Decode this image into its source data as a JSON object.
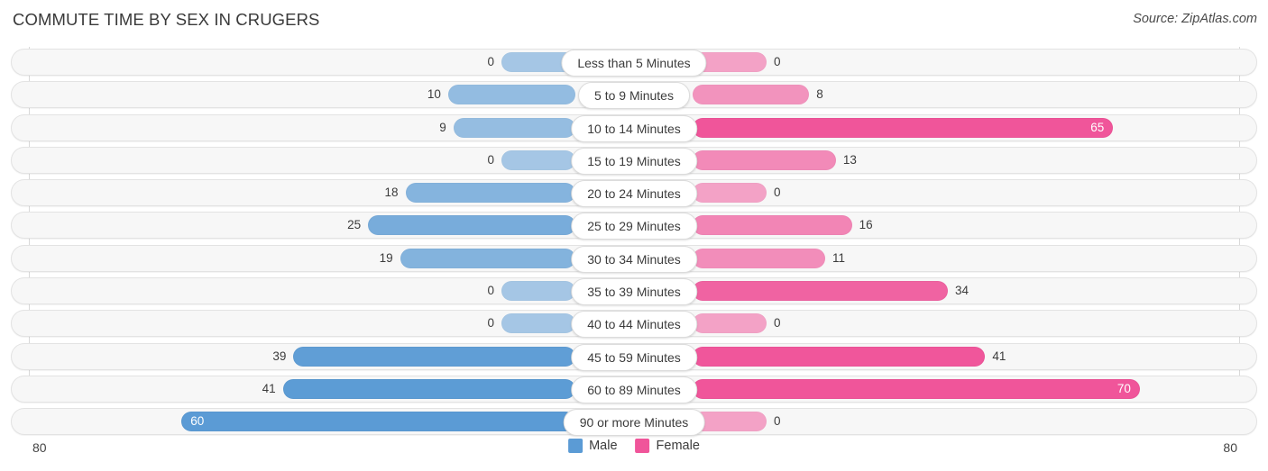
{
  "header": {
    "title": "COMMUTE TIME BY SEX IN CRUGERS",
    "source": "Source: ZipAtlas.com"
  },
  "legend": {
    "male_label": "Male",
    "female_label": "Female",
    "male_color": "#5b9bd5",
    "female_color": "#f0559a"
  },
  "axis": {
    "left_max_label": "80",
    "right_max_label": "80"
  },
  "chart_data": {
    "type": "bar",
    "title": "COMMUTE TIME BY SEX IN CRUGERS",
    "subtitle": "Source: ZipAtlas.com",
    "orientation": "horizontal-diverging",
    "xlabel": "",
    "ylabel": "",
    "xlim": [
      80,
      80
    ],
    "grid": true,
    "legend_position": "bottom-center",
    "categories": [
      "Less than 5 Minutes",
      "5 to 9 Minutes",
      "10 to 14 Minutes",
      "15 to 19 Minutes",
      "20 to 24 Minutes",
      "25 to 29 Minutes",
      "30 to 34 Minutes",
      "35 to 39 Minutes",
      "40 to 44 Minutes",
      "45 to 59 Minutes",
      "60 to 89 Minutes",
      "90 or more Minutes"
    ],
    "series": [
      {
        "name": "Male",
        "color": "#5b9bd5",
        "values": [
          0,
          10,
          9,
          0,
          18,
          25,
          19,
          0,
          0,
          39,
          41,
          60
        ]
      },
      {
        "name": "Female",
        "color": "#f0559a",
        "values": [
          0,
          8,
          65,
          13,
          0,
          16,
          11,
          34,
          0,
          41,
          70,
          0
        ]
      }
    ]
  },
  "rows": [
    {
      "label": "Less than 5 Minutes",
      "male": "0",
      "female": "0",
      "male_inside": false,
      "female_inside": false
    },
    {
      "label": "5 to 9 Minutes",
      "male": "10",
      "female": "8",
      "male_inside": false,
      "female_inside": false
    },
    {
      "label": "10 to 14 Minutes",
      "male": "9",
      "female": "65",
      "male_inside": false,
      "female_inside": true
    },
    {
      "label": "15 to 19 Minutes",
      "male": "0",
      "female": "13",
      "male_inside": false,
      "female_inside": false
    },
    {
      "label": "20 to 24 Minutes",
      "male": "18",
      "female": "0",
      "male_inside": false,
      "female_inside": false
    },
    {
      "label": "25 to 29 Minutes",
      "male": "25",
      "female": "16",
      "male_inside": false,
      "female_inside": false
    },
    {
      "label": "30 to 34 Minutes",
      "male": "19",
      "female": "11",
      "male_inside": false,
      "female_inside": false
    },
    {
      "label": "35 to 39 Minutes",
      "male": "0",
      "female": "34",
      "male_inside": false,
      "female_inside": false
    },
    {
      "label": "40 to 44 Minutes",
      "male": "0",
      "female": "0",
      "male_inside": false,
      "female_inside": false
    },
    {
      "label": "45 to 59 Minutes",
      "male": "39",
      "female": "41",
      "male_inside": false,
      "female_inside": false
    },
    {
      "label": "60 to 89 Minutes",
      "male": "41",
      "female": "70",
      "male_inside": false,
      "female_inside": true
    },
    {
      "label": "90 or more Minutes",
      "male": "60",
      "female": "0",
      "male_inside": true,
      "female_inside": false
    }
  ]
}
